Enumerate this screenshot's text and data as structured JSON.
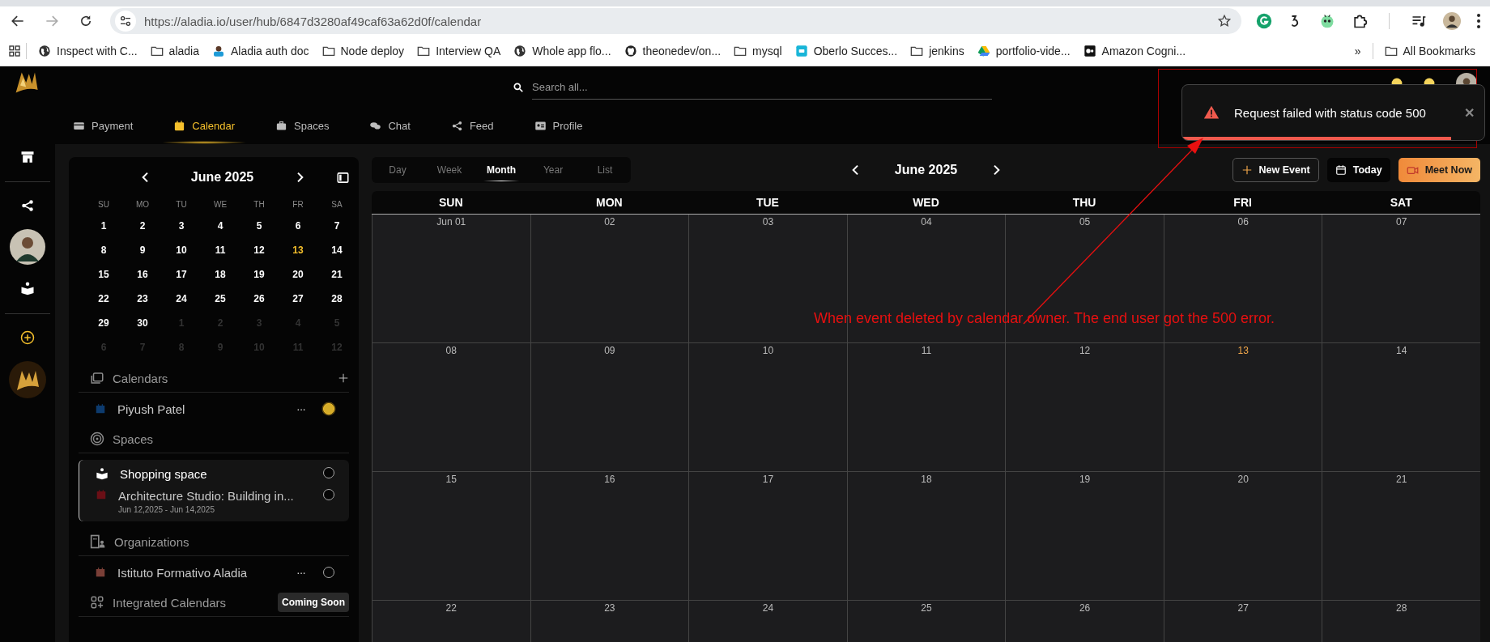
{
  "browser": {
    "url": "https://aladia.io/user/hub/6847d3280af49caf63a62d0f/calendar",
    "bookmarks": [
      {
        "label": "Inspect with C...",
        "kind": "globe"
      },
      {
        "label": "aladia",
        "kind": "folder"
      },
      {
        "label": "Aladia auth doc",
        "kind": "person"
      },
      {
        "label": "Node deploy",
        "kind": "folder"
      },
      {
        "label": "Interview QA",
        "kind": "folder"
      },
      {
        "label": "Whole app flo...",
        "kind": "globe"
      },
      {
        "label": "theonedev/on...",
        "kind": "github"
      },
      {
        "label": "mysql",
        "kind": "folder"
      },
      {
        "label": "Oberlo Succes...",
        "kind": "tile"
      },
      {
        "label": "jenkins",
        "kind": "folder"
      },
      {
        "label": "portfolio-vide...",
        "kind": "drive"
      },
      {
        "label": "Amazon Cogni...",
        "kind": "square"
      }
    ],
    "more": "»",
    "all_bookmarks": "All Bookmarks"
  },
  "header": {
    "search": {
      "placeholder": "Search all..."
    }
  },
  "nav_tabs": [
    {
      "label": "Payment",
      "selected": false,
      "kind": "card"
    },
    {
      "label": "Calendar",
      "selected": true,
      "kind": "calendar"
    },
    {
      "label": "Spaces",
      "selected": false,
      "kind": "briefcase"
    },
    {
      "label": "Chat",
      "selected": false,
      "kind": "chat"
    },
    {
      "label": "Feed",
      "selected": false,
      "kind": "share"
    },
    {
      "label": "Profile",
      "selected": false,
      "kind": "idcard"
    }
  ],
  "mini_calendar": {
    "title": "June 2025",
    "weekdays": [
      "SU",
      "MO",
      "TU",
      "WE",
      "TH",
      "FR",
      "SA"
    ],
    "days": [
      {
        "label": "1",
        "muted": false,
        "today": false
      },
      {
        "label": "2",
        "muted": false,
        "today": false
      },
      {
        "label": "3",
        "muted": false,
        "today": false
      },
      {
        "label": "4",
        "muted": false,
        "today": false
      },
      {
        "label": "5",
        "muted": false,
        "today": false
      },
      {
        "label": "6",
        "muted": false,
        "today": false
      },
      {
        "label": "7",
        "muted": false,
        "today": false
      },
      {
        "label": "8",
        "muted": false,
        "today": false
      },
      {
        "label": "9",
        "muted": false,
        "today": false
      },
      {
        "label": "10",
        "muted": false,
        "today": false
      },
      {
        "label": "11",
        "muted": false,
        "today": false
      },
      {
        "label": "12",
        "muted": false,
        "today": false
      },
      {
        "label": "13",
        "muted": false,
        "today": true
      },
      {
        "label": "14",
        "muted": false,
        "today": false
      },
      {
        "label": "15",
        "muted": false,
        "today": false
      },
      {
        "label": "16",
        "muted": false,
        "today": false
      },
      {
        "label": "17",
        "muted": false,
        "today": false
      },
      {
        "label": "18",
        "muted": false,
        "today": false
      },
      {
        "label": "19",
        "muted": false,
        "today": false
      },
      {
        "label": "20",
        "muted": false,
        "today": false
      },
      {
        "label": "21",
        "muted": false,
        "today": false
      },
      {
        "label": "22",
        "muted": false,
        "today": false
      },
      {
        "label": "23",
        "muted": false,
        "today": false
      },
      {
        "label": "24",
        "muted": false,
        "today": false
      },
      {
        "label": "25",
        "muted": false,
        "today": false
      },
      {
        "label": "26",
        "muted": false,
        "today": false
      },
      {
        "label": "27",
        "muted": false,
        "today": false
      },
      {
        "label": "28",
        "muted": false,
        "today": false
      },
      {
        "label": "29",
        "muted": false,
        "today": false
      },
      {
        "label": "30",
        "muted": false,
        "today": false
      },
      {
        "label": "1",
        "muted": true,
        "today": false
      },
      {
        "label": "2",
        "muted": true,
        "today": false
      },
      {
        "label": "3",
        "muted": true,
        "today": false
      },
      {
        "label": "4",
        "muted": true,
        "today": false
      },
      {
        "label": "5",
        "muted": true,
        "today": false
      },
      {
        "label": "6",
        "muted": true,
        "today": false
      },
      {
        "label": "7",
        "muted": true,
        "today": false
      },
      {
        "label": "8",
        "muted": true,
        "today": false
      },
      {
        "label": "9",
        "muted": true,
        "today": false
      },
      {
        "label": "10",
        "muted": true,
        "today": false
      },
      {
        "label": "11",
        "muted": true,
        "today": false
      },
      {
        "label": "12",
        "muted": true,
        "today": false
      }
    ]
  },
  "sections": [
    {
      "title": "Calendars",
      "kind": "calendars",
      "items": [
        {
          "label": "Piyush Patel",
          "color": "#0d3b6e",
          "checked": true,
          "menu": "···"
        }
      ]
    },
    {
      "title": "Spaces",
      "kind": "spaces",
      "group": {
        "title": "Shopping space",
        "checked": false,
        "items": [
          {
            "label": "Architecture Studio: Building in...",
            "subtitle": "Jun 12,2025 - Jun 14,2025",
            "color": "#6b0f16",
            "checked": false
          }
        ]
      }
    },
    {
      "title": "Organizations",
      "kind": "organizations",
      "items": [
        {
          "label": "Istituto Formativo Aladia",
          "color": "#7a3f37",
          "checked": false,
          "menu": "···"
        }
      ]
    },
    {
      "title": "Integrated Calendars",
      "kind": "integrated",
      "badge": "Coming Soon"
    }
  ],
  "calendar": {
    "views": [
      {
        "label": "Day",
        "selected": false
      },
      {
        "label": "Week",
        "selected": false
      },
      {
        "label": "Month",
        "selected": true
      },
      {
        "label": "Year",
        "selected": false
      },
      {
        "label": "List",
        "selected": false
      }
    ],
    "title": "June 2025",
    "new_event": "New Event",
    "today": "Today",
    "meet_now": "Meet Now",
    "weekdays": [
      "SUN",
      "MON",
      "TUE",
      "WED",
      "THU",
      "FRI",
      "SAT"
    ],
    "weeks": [
      [
        {
          "label": "Jun 01",
          "today": false
        },
        {
          "label": "02",
          "today": false
        },
        {
          "label": "03",
          "today": false
        },
        {
          "label": "04",
          "today": false
        },
        {
          "label": "05",
          "today": false
        },
        {
          "label": "06",
          "today": false
        },
        {
          "label": "07",
          "today": false
        }
      ],
      [
        {
          "label": "08",
          "today": false
        },
        {
          "label": "09",
          "today": false
        },
        {
          "label": "10",
          "today": false
        },
        {
          "label": "11",
          "today": false
        },
        {
          "label": "12",
          "today": false
        },
        {
          "label": "13",
          "today": true
        },
        {
          "label": "14",
          "today": false
        }
      ],
      [
        {
          "label": "15",
          "today": false
        },
        {
          "label": "16",
          "today": false
        },
        {
          "label": "17",
          "today": false
        },
        {
          "label": "18",
          "today": false
        },
        {
          "label": "19",
          "today": false
        },
        {
          "label": "20",
          "today": false
        },
        {
          "label": "21",
          "today": false
        }
      ],
      [
        {
          "label": "22",
          "today": false
        },
        {
          "label": "23",
          "today": false
        },
        {
          "label": "24",
          "today": false
        },
        {
          "label": "25",
          "today": false
        },
        {
          "label": "26",
          "today": false
        },
        {
          "label": "27",
          "today": false
        },
        {
          "label": "28",
          "today": false
        }
      ]
    ]
  },
  "toast": {
    "message": "Request failed with status code 500",
    "close": "✕",
    "level": 0.89
  },
  "annotation": {
    "note": "When event deleted by calendar owner. The end user got the 500 error."
  }
}
